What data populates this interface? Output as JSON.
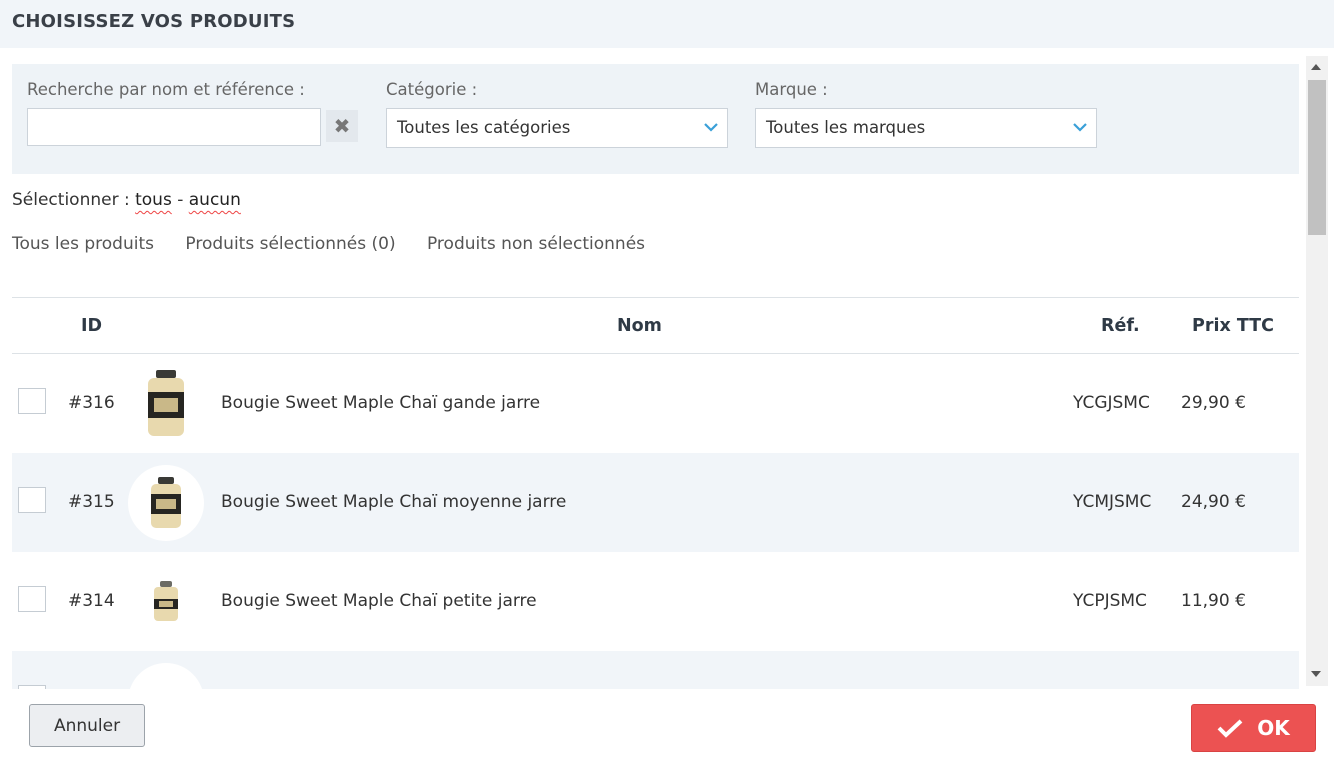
{
  "header": {
    "title": "CHOISISSEZ VOS PRODUITS"
  },
  "filters": {
    "search_label": "Recherche par nom et référence :",
    "search_value": "",
    "category_label": "Catégorie :",
    "category_value": "Toutes les catégories",
    "brand_label": "Marque :",
    "brand_value": "Toutes les marques"
  },
  "selector": {
    "prefix": "Sélectionner :",
    "all": "tous",
    "sep": "-",
    "none": "aucun"
  },
  "tabs": [
    "Tous les produits",
    "Produits sélectionnés (0)",
    "Produits non sélectionnés"
  ],
  "table": {
    "headers": {
      "id": "ID",
      "name": "Nom",
      "ref": "Réf.",
      "price": "Prix TTC"
    },
    "rows": [
      {
        "id": "#316",
        "name": "Bougie Sweet Maple Chaï gande jarre",
        "ref": "YCGJSMC",
        "price": "29,90 €",
        "size": "large"
      },
      {
        "id": "#315",
        "name": "Bougie Sweet Maple Chaï moyenne jarre",
        "ref": "YCMJSMC",
        "price": "24,90 €",
        "size": "medium"
      },
      {
        "id": "#314",
        "name": "Bougie Sweet Maple Chaï petite jarre",
        "ref": "YCPJSMC",
        "price": "11,90 €",
        "size": "small"
      }
    ]
  },
  "footer": {
    "cancel_label": "Annuler",
    "ok_label": "OK"
  },
  "colors": {
    "accent": "#ec5252",
    "header_bg": "#f1f5f9",
    "chevron": "#3aa0d8"
  }
}
